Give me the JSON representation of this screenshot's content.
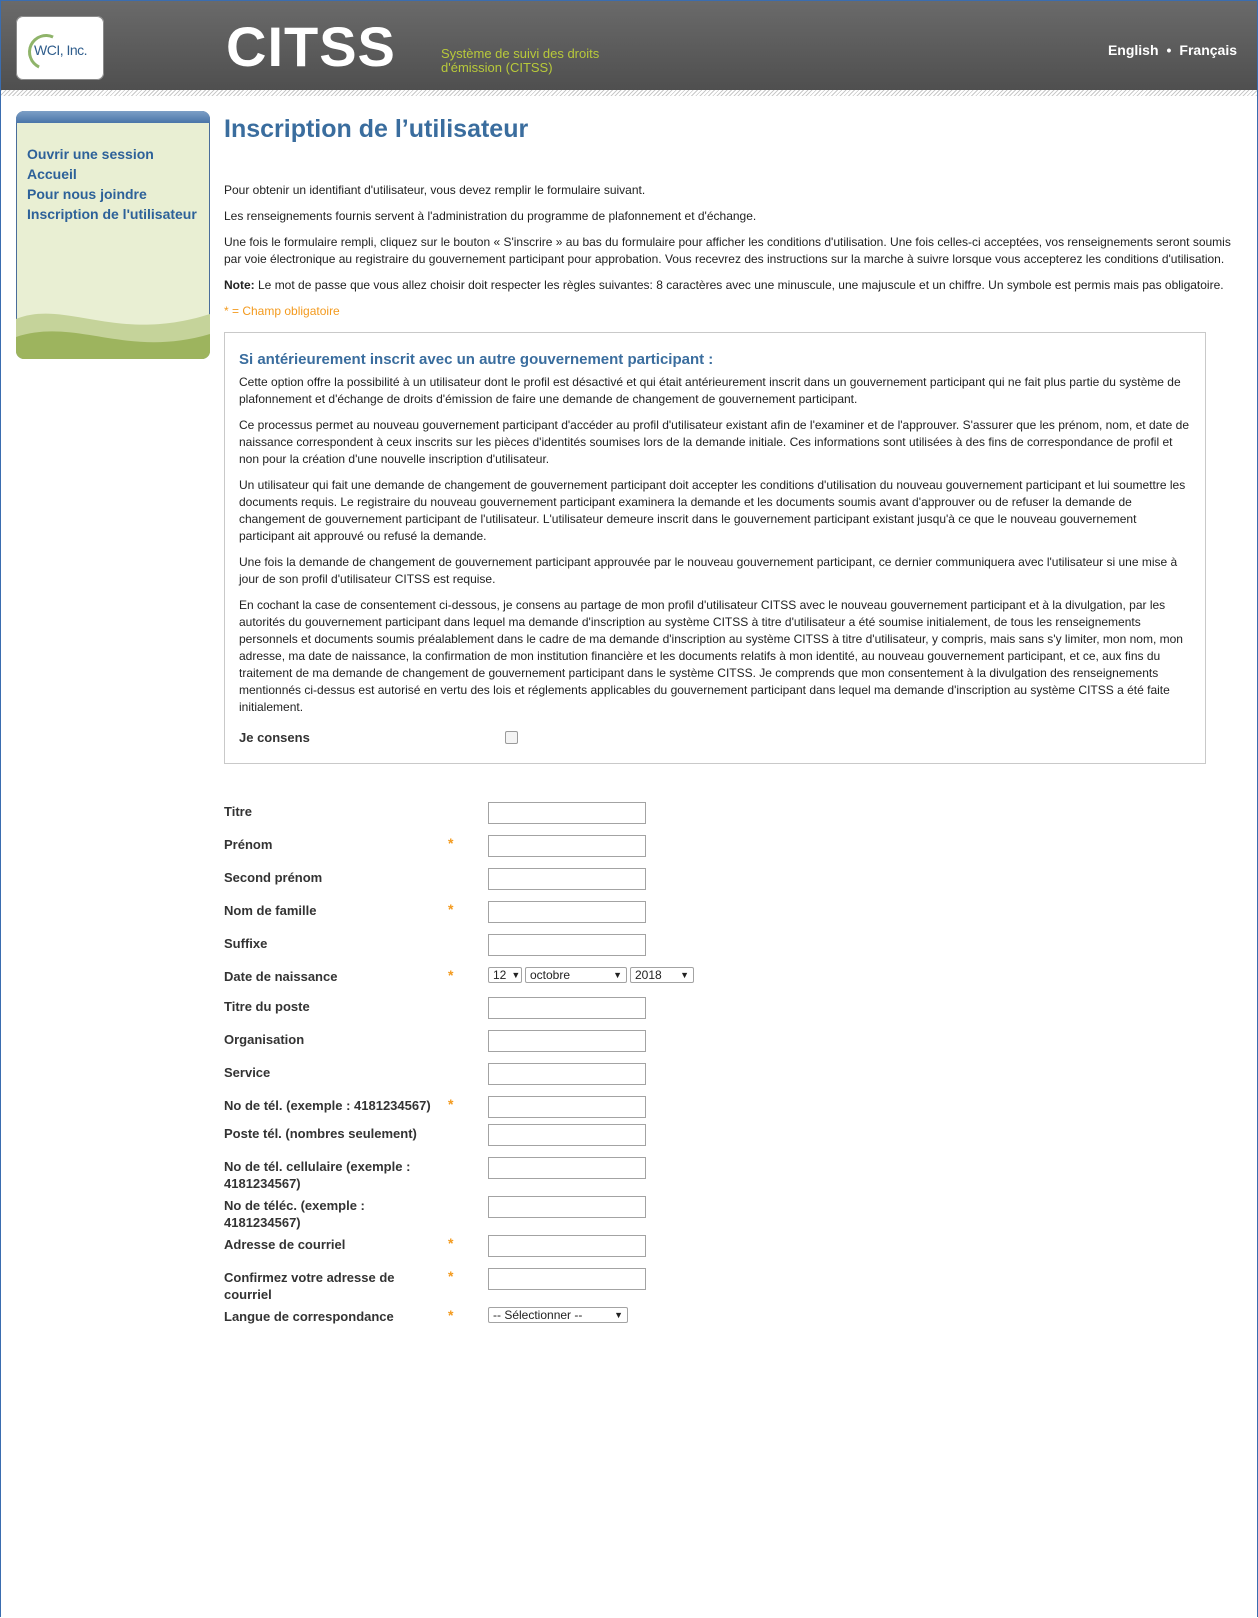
{
  "header": {
    "logo_text": "WCI, Inc.",
    "title": "CITSS",
    "subtitle": "Système de suivi des droits d'émission (CITSS)",
    "lang_en": "English",
    "lang_sep": "•",
    "lang_fr": "Français"
  },
  "sidebar": {
    "items": [
      {
        "label": "Ouvrir une session"
      },
      {
        "label": "Accueil"
      },
      {
        "label": "Pour nous joindre"
      },
      {
        "label": "Inscription de l'utilisateur"
      }
    ]
  },
  "main": {
    "title": "Inscription de l’utilisateur",
    "p1": "Pour obtenir un identifiant d'utilisateur, vous devez remplir le formulaire suivant.",
    "p2": "Les renseignements fournis servent à l'administration du programme de plafonnement et d'échange.",
    "p3": "Une fois le formulaire rempli, cliquez sur le bouton « S'inscrire » au bas du formulaire pour afficher les conditions d'utilisation. Une fois celles-ci acceptées, vos renseignements seront soumis par voie électronique au registraire du gouvernement participant pour approbation. Vous recevrez des instructions sur la marche à suivre lorsque vous accepterez les conditions d'utilisation.",
    "note_label": "Note:",
    "note_text": " Le mot de passe que vous allez choisir doit respecter les règles suivantes: 8 caractères avec une minuscule, une majuscule et un chiffre. Un symbole est permis mais pas obligatoire.",
    "required_note": "* = Champ obligatoire"
  },
  "transfer": {
    "title": "Si antérieurement inscrit avec un autre gouvernement participant :",
    "p1": "Cette option offre la possibilité à un utilisateur dont le profil est désactivé et qui était antérieurement inscrit dans un gouvernement participant qui ne fait plus partie du système de plafonnement et d'échange de droits d'émission de faire une demande de changement de gouvernement participant.",
    "p2": "Ce processus permet au nouveau gouvernement participant d'accéder au profil d'utilisateur existant afin de l'examiner et de l'approuver. S'assurer que les prénom, nom, et date de naissance correspondent à ceux inscrits sur les pièces d'identités soumises lors de la demande initiale. Ces informations sont utilisées à des fins de correspondance de profil et non pour la création d'une nouvelle inscription d'utilisateur.",
    "p3": "Un utilisateur qui fait une demande de changement de gouvernement participant doit accepter les conditions d'utilisation du nouveau gouvernement participant et lui soumettre les documents requis. Le registraire du nouveau gouvernement participant examinera la demande et les documents soumis avant d'approuver ou de refuser la demande de changement de gouvernement participant de l'utilisateur. L'utilisateur demeure inscrit dans le gouvernement participant existant jusqu'à ce que le nouveau gouvernement participant ait approuvé ou refusé la demande.",
    "p4": "Une fois la demande de changement de gouvernement participant approuvée par le nouveau gouvernement participant, ce dernier communiquera avec l'utilisateur si une mise à jour de son profil d'utilisateur CITSS est requise.",
    "p5": "En cochant la case de consentement ci-dessous, je consens au partage de mon profil d'utilisateur CITSS avec le nouveau gouvernement participant et à la divulgation, par les autorités du gouvernement participant dans lequel ma demande d'inscription au système CITSS à titre d'utilisateur a été soumise initialement, de tous les renseignements personnels et documents soumis préalablement dans le cadre de ma demande d'inscription au système CITSS à titre d'utilisateur, y compris, mais sans s'y limiter, mon nom, mon adresse, ma date de naissance, la confirmation de mon institution financière et les documents relatifs à mon identité, au nouveau gouvernement participant, et ce, aux fins du traitement de ma demande de changement de gouvernement participant dans le système CITSS. Je comprends que mon consentement à la divulgation des renseignements mentionnés ci-dessus est autorisé en vertu des lois et réglements applicables du gouvernement participant dans lequel ma demande d'inscription au système CITSS a été faite initialement.",
    "consent_label": "Je consens",
    "consent_checked": false
  },
  "form": {
    "required_mark": "*",
    "fields": [
      {
        "label": "Titre",
        "required": false,
        "value": ""
      },
      {
        "label": "Prénom",
        "required": true,
        "value": ""
      },
      {
        "label": "Second prénom",
        "required": false,
        "value": ""
      },
      {
        "label": "Nom de famille",
        "required": true,
        "value": ""
      },
      {
        "label": "Suffixe",
        "required": false,
        "value": ""
      },
      {
        "label": "Date de naissance",
        "required": true,
        "day": "12",
        "month": "octobre",
        "year": "2018"
      },
      {
        "label": "Titre du poste",
        "required": false,
        "value": ""
      },
      {
        "label": "Organisation",
        "required": false,
        "value": ""
      },
      {
        "label": "Service",
        "required": false,
        "value": ""
      },
      {
        "label": "No de tél. (exemple : 4181234567)",
        "required": true,
        "value": ""
      },
      {
        "label": "Poste tél. (nombres seulement)",
        "required": false,
        "value": ""
      },
      {
        "label": "No de tél. cellulaire (exemple : 4181234567)",
        "required": false,
        "value": ""
      },
      {
        "label": "No de téléc. (exemple : 4181234567)",
        "required": false,
        "value": ""
      },
      {
        "label": "Adresse de courriel",
        "required": true,
        "value": ""
      },
      {
        "label": "Confirmez votre adresse de courriel",
        "required": true,
        "value": ""
      },
      {
        "label": "Langue de correspondance",
        "required": true,
        "selected": "-- Sélectionner --"
      }
    ],
    "select_arrow": "▼"
  },
  "colors": {
    "header_bg": "#5a5a5a",
    "title_blue": "#3a6d9e",
    "nav_blue": "#2d6199",
    "required_orange": "#f39a1e",
    "sidebar_bg": "#e9efd3",
    "subtitle_green": "#b8c93a"
  }
}
